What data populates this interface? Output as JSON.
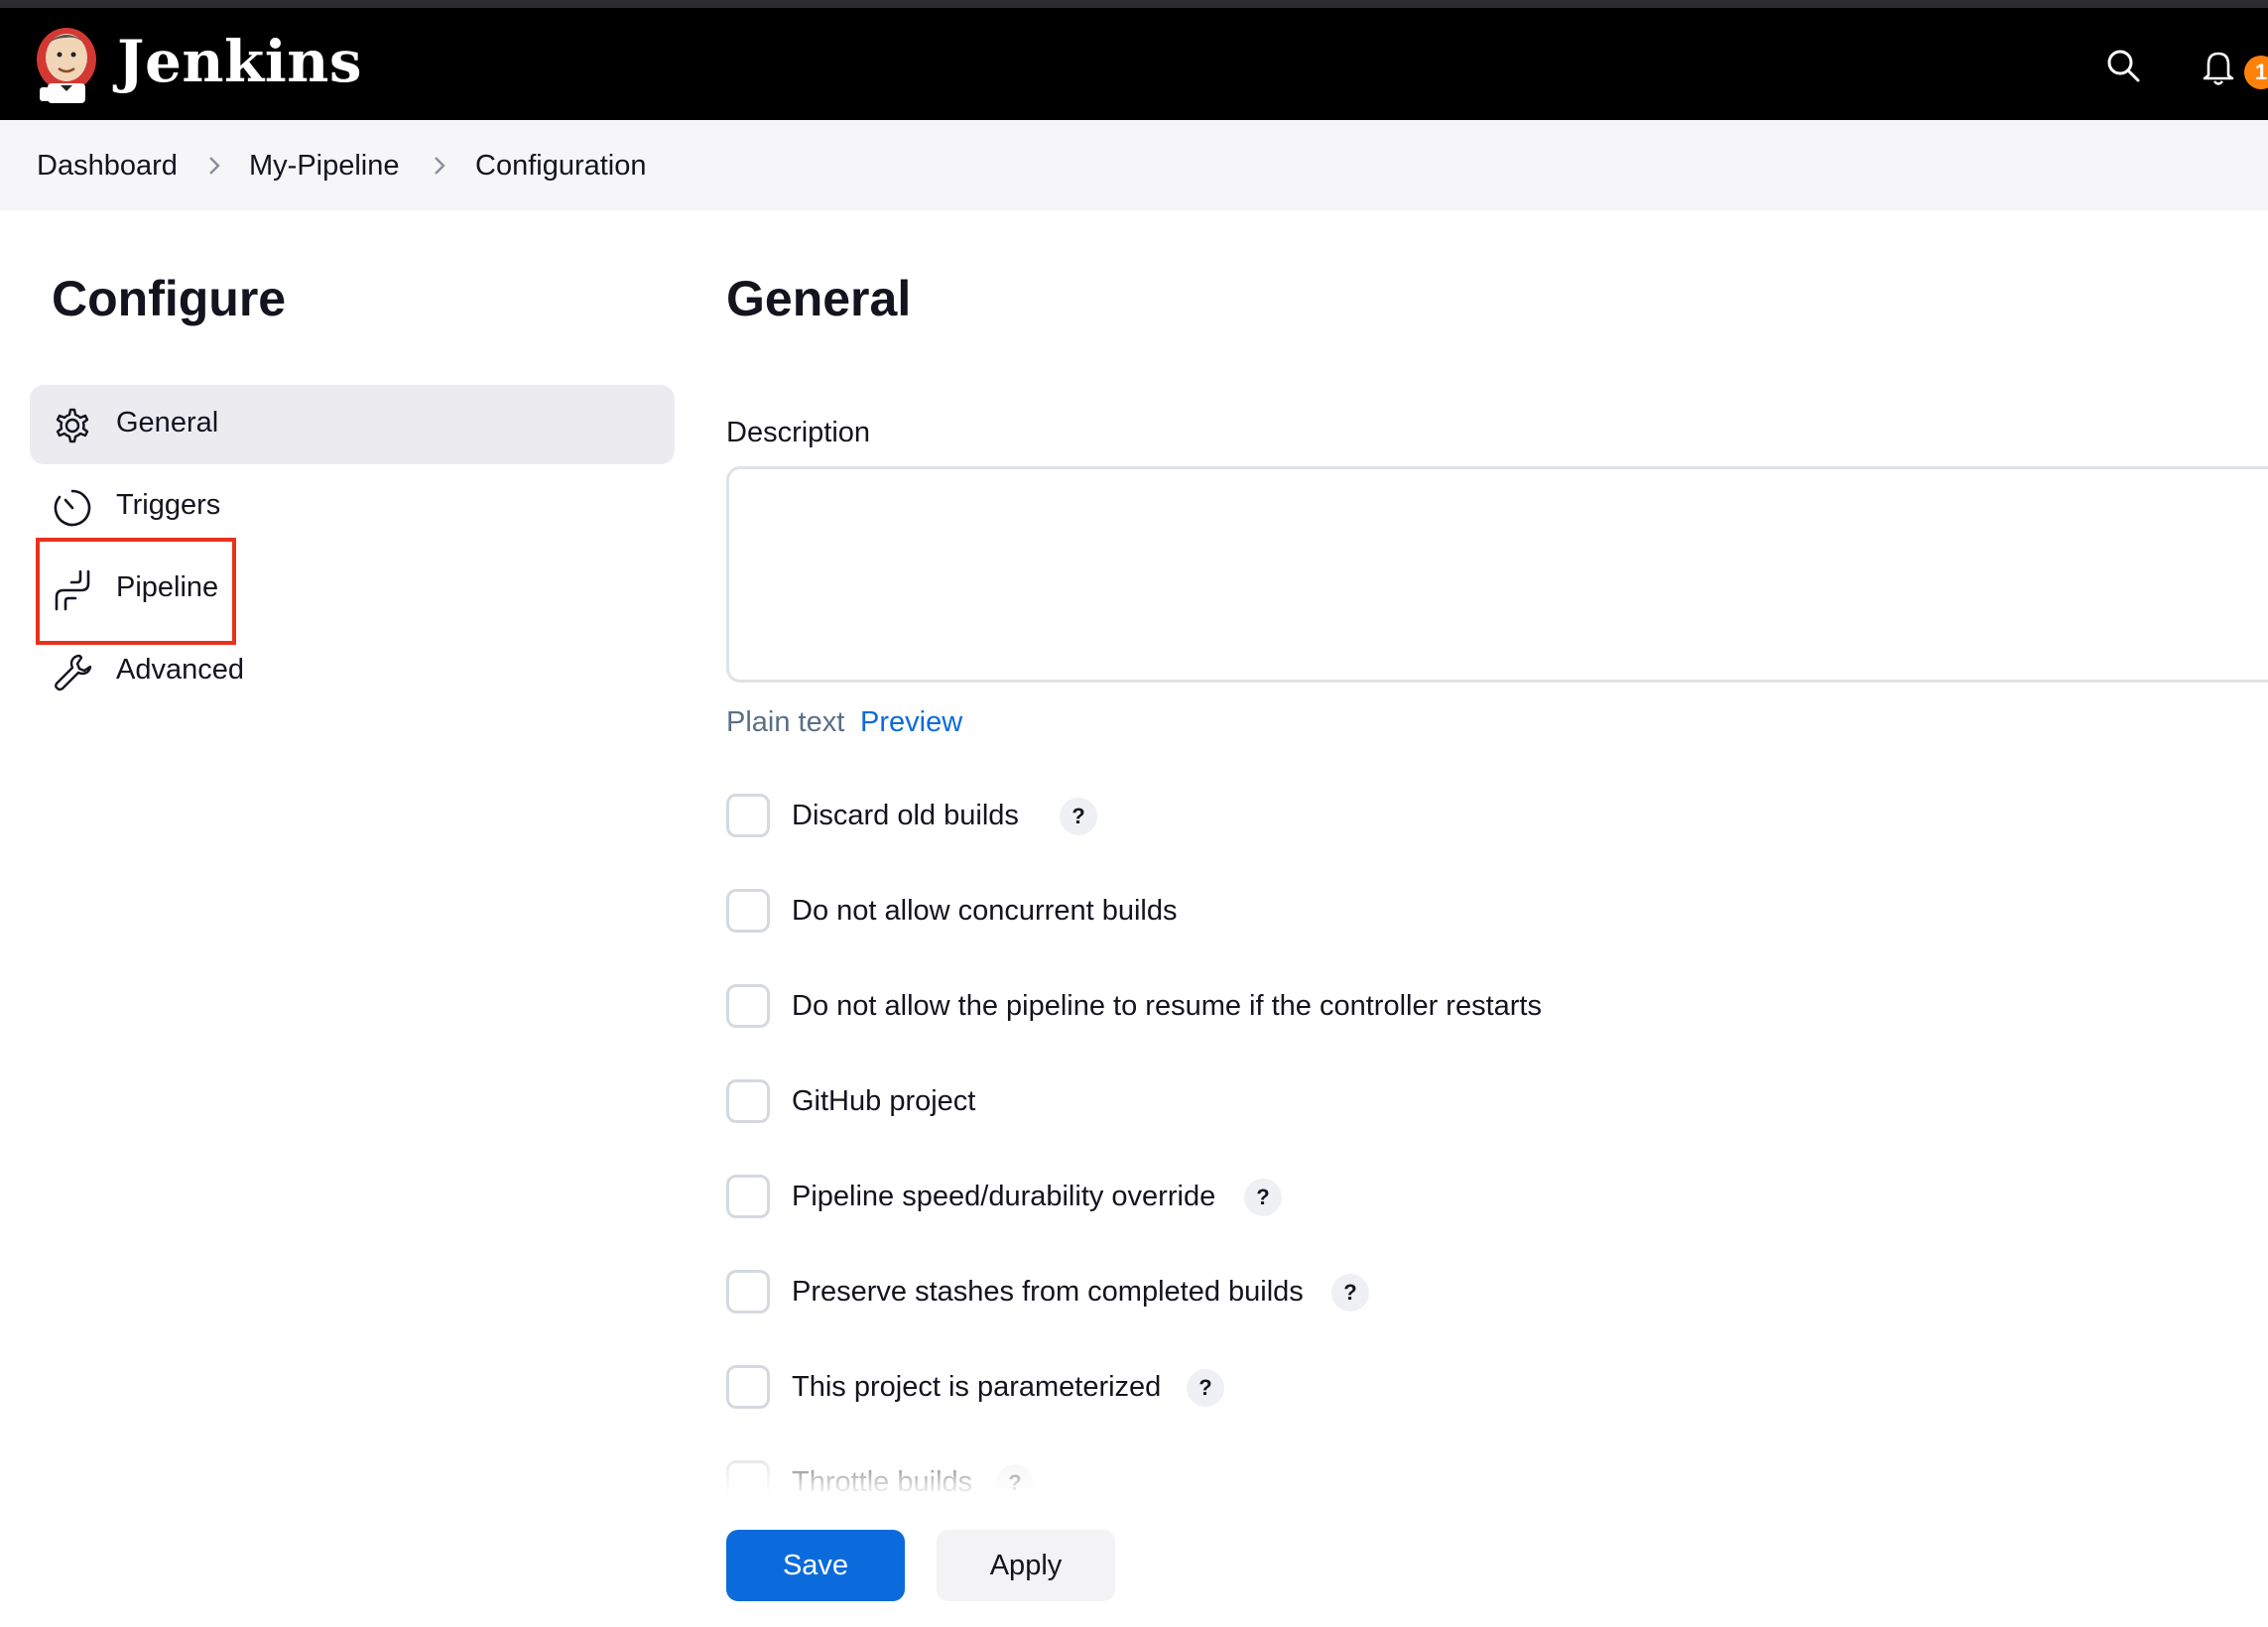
{
  "header": {
    "brand": "Jenkins",
    "notification_count": "1",
    "colors": {
      "bar": "#000000",
      "badge": "#fe820a"
    }
  },
  "breadcrumb": {
    "items": [
      "Dashboard",
      "My-Pipeline",
      "Configuration"
    ]
  },
  "sidebar": {
    "title": "Configure",
    "items": [
      {
        "label": "General",
        "icon": "gear-icon",
        "active": true
      },
      {
        "label": "Triggers",
        "icon": "clock-icon",
        "active": false
      },
      {
        "label": "Pipeline",
        "icon": "pipeline-icon",
        "active": false,
        "highlighted": true
      },
      {
        "label": "Advanced",
        "icon": "wrench-icon",
        "active": false
      }
    ]
  },
  "main": {
    "title": "General",
    "description": {
      "label": "Description",
      "value": "",
      "format_plain": "Plain text",
      "format_preview": "Preview"
    },
    "options": [
      {
        "label": "Discard old builds",
        "checked": false,
        "help": "?"
      },
      {
        "label": "Do not allow concurrent builds",
        "checked": false
      },
      {
        "label": "Do not allow the pipeline to resume if the controller restarts",
        "checked": false
      },
      {
        "label": "GitHub project",
        "checked": false
      },
      {
        "label": "Pipeline speed/durability override",
        "checked": false,
        "help": "?"
      },
      {
        "label": "Preserve stashes from completed builds",
        "checked": false,
        "help": "?"
      },
      {
        "label": "This project is parameterized",
        "checked": false,
        "help": "?"
      },
      {
        "label": "Throttle builds",
        "checked": false,
        "help": "?"
      }
    ]
  },
  "actions": {
    "save": "Save",
    "apply": "Apply",
    "colors": {
      "primary": "#0b6bdc"
    }
  }
}
